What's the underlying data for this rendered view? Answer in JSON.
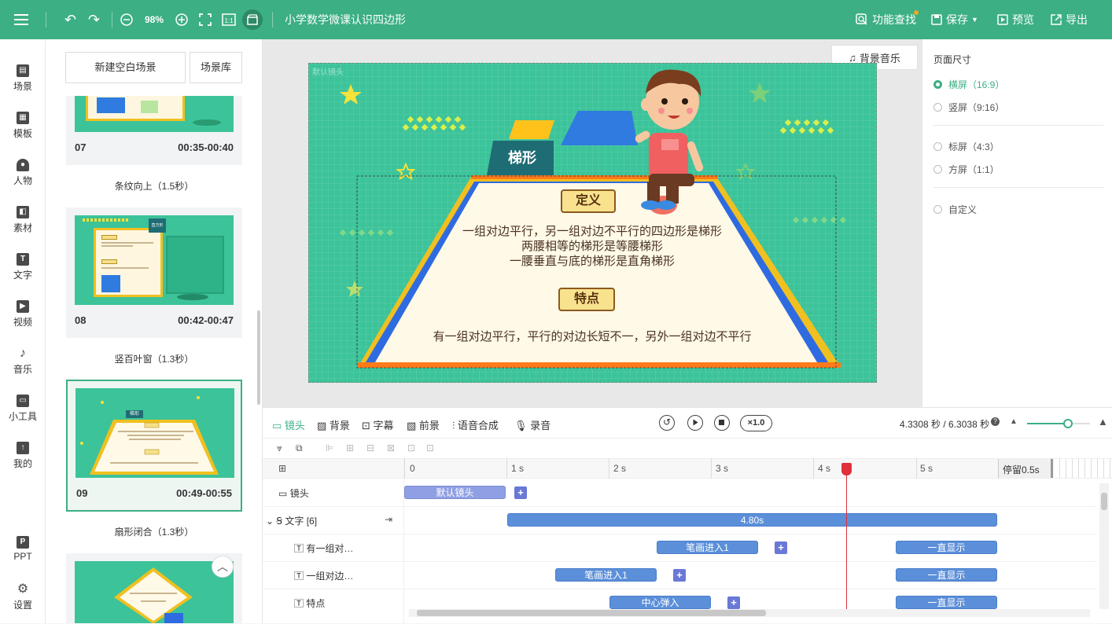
{
  "toolbar": {
    "zoom": "98%",
    "title": "小学数学微课认识四边形",
    "find_label": "功能查找",
    "save_label": "保存",
    "preview_label": "预览",
    "export_label": "导出"
  },
  "nav": [
    {
      "label": "场景",
      "icon": "scene-icon"
    },
    {
      "label": "模板",
      "icon": "template-icon"
    },
    {
      "label": "人物",
      "icon": "person-icon"
    },
    {
      "label": "素材",
      "icon": "material-icon"
    },
    {
      "label": "文字",
      "icon": "text-icon"
    },
    {
      "label": "视频",
      "icon": "video-icon"
    },
    {
      "label": "音乐",
      "icon": "music-icon"
    },
    {
      "label": "小工具",
      "icon": "toolbox-icon"
    },
    {
      "label": "我的",
      "icon": "my-icon"
    },
    {
      "label": "PPT",
      "icon": "ppt-icon"
    },
    {
      "label": "设置",
      "icon": "gear-icon"
    }
  ],
  "scenes_panel": {
    "new_blank": "新建空白场景",
    "library": "场景库",
    "cards": [
      {
        "num": "07",
        "time": "00:35-00:40",
        "transition": "条纹向上（1.5秒）"
      },
      {
        "num": "08",
        "time": "00:42-00:47",
        "transition": "竖百叶窗（1.3秒）",
        "thumb_tag": "直方形"
      },
      {
        "num": "09",
        "time": "00:49-00:55",
        "transition": "扇形闭合（1.3秒）",
        "thumb_tag": "梯形"
      }
    ]
  },
  "canvas": {
    "bg_music": "背景音乐",
    "camera_tag": "默认镜头",
    "shape_label": "梯形",
    "def_title": "定义",
    "def_lines": [
      "一组对边平行，另一组对边不平行的四边形是梯形",
      "两腰相等的梯形是等腰梯形",
      "一腰垂直与底的梯形是直角梯形"
    ],
    "feat_title": "特点",
    "feat_text": "有一组对边平行，平行的对边长短不一，另外一组对边不平行"
  },
  "page_size": {
    "title": "页面尺寸",
    "options": [
      {
        "label": "横屏（16:9）",
        "selected": true
      },
      {
        "label": "竖屏（9:16）",
        "selected": false
      },
      {
        "label": "标屏（4:3）",
        "selected": false
      },
      {
        "label": "方屏（1:1）",
        "selected": false
      },
      {
        "label": "自定义",
        "selected": false
      }
    ]
  },
  "timeline": {
    "tabs": [
      "镜头",
      "背景",
      "字幕",
      "前景",
      "语音合成",
      "录音"
    ],
    "speed": "×1.0",
    "time_display": "4.3308 秒 / 6.3038 秒",
    "ruler": [
      "0",
      "1 s",
      "2 s",
      "3 s",
      "4 s",
      "5 s"
    ],
    "pause": "停留0.5s",
    "tracks": {
      "camera": {
        "label": "镜头",
        "block": "默认镜头"
      },
      "text_group": {
        "label": "文字 [6]",
        "block": "4.80s"
      },
      "t1": {
        "label": "有一组对…",
        "b1": "笔画进入1",
        "b2": "一直显示"
      },
      "t2": {
        "label": "一组对边…",
        "b1": "笔画进入1",
        "b2": "一直显示"
      },
      "t3": {
        "label": "特点",
        "b1": "中心弹入",
        "b2": "一直显示"
      }
    }
  },
  "colors": {
    "accent": "#3caf84",
    "canvas_bg": "#3cc39a",
    "block_blue": "#5b8fd9",
    "playhead": "#e0303a"
  }
}
